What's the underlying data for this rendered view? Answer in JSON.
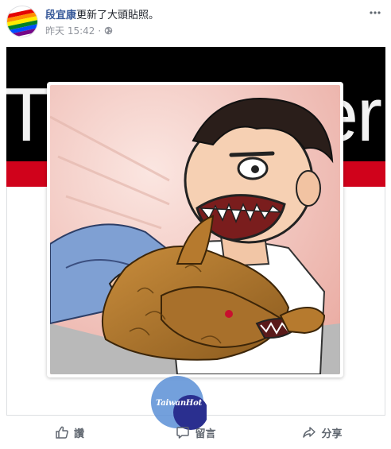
{
  "post": {
    "author_name": "段宜康",
    "action_text": "更新了大頭貼照。",
    "timestamp": "昨天 15:42",
    "separator": "·",
    "privacy_icon": "globe-icon",
    "more_icon": "more-options-icon"
  },
  "cover": {
    "left_text": "Th",
    "right_text": "er"
  },
  "watermark": {
    "text": "TaiwanHot"
  },
  "actions": {
    "like_label": "讚",
    "comment_label": "留言",
    "share_label": "分享"
  },
  "colors": {
    "author_link": "#365899",
    "meta_gray": "#90949c",
    "action_gray": "#606770",
    "cover_red": "#d0021b",
    "watermark_blue": "#2a2f8f",
    "watermark_light": "#5b8fd6"
  }
}
